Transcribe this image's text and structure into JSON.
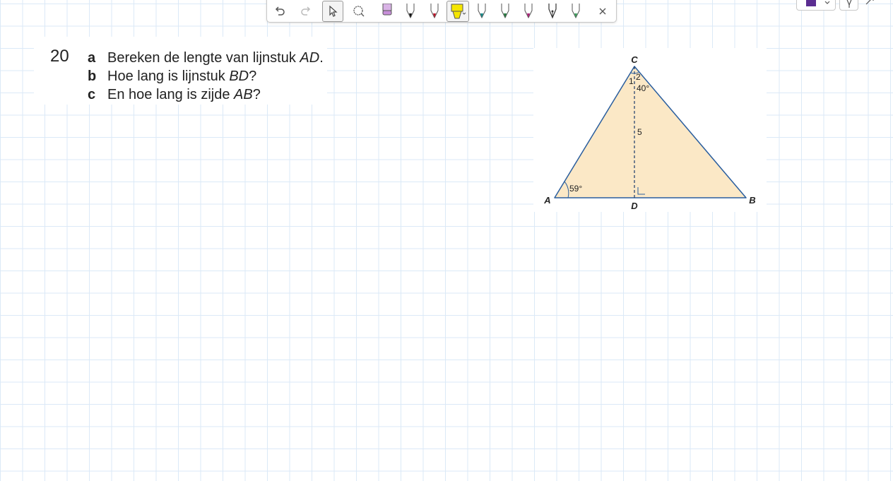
{
  "toolbar": {
    "tools": [
      "undo-icon",
      "redo-icon",
      "pointer-icon",
      "lasso-icon",
      "eraser-icon",
      "pen-black-icon",
      "pen-red-icon",
      "highlighter-yellow-icon",
      "pen-teal-icon",
      "pen-green-icon",
      "pen-magenta-icon",
      "fountain-pen-icon",
      "pen-light-green-icon",
      "close-icon"
    ],
    "selected_tool": "pointer-icon",
    "active_highlighter_color": "#f5e600"
  },
  "color_picker": {
    "color": "#5b2d91"
  },
  "exercise": {
    "number": "20",
    "questions": [
      {
        "letter": "a",
        "text_before": "Bereken de lengte van lijnstuk ",
        "italic": "AD",
        "text_after": "."
      },
      {
        "letter": "b",
        "text_before": "Hoe lang is lijnstuk ",
        "italic": "BD",
        "text_after": "?"
      },
      {
        "letter": "c",
        "text_before": "En hoe lang is zijde ",
        "italic": "AB",
        "text_after": "?"
      }
    ]
  },
  "figure": {
    "vertices": {
      "a": "A",
      "b": "B",
      "c": "C",
      "d": "D"
    },
    "angle_a": "59°",
    "angle_c2": "40°",
    "angle_label_1": "1",
    "angle_label_2": "2",
    "length_cd": "5",
    "fill_color": "#fbe8c6",
    "stroke_color": "#2a5e9e"
  }
}
